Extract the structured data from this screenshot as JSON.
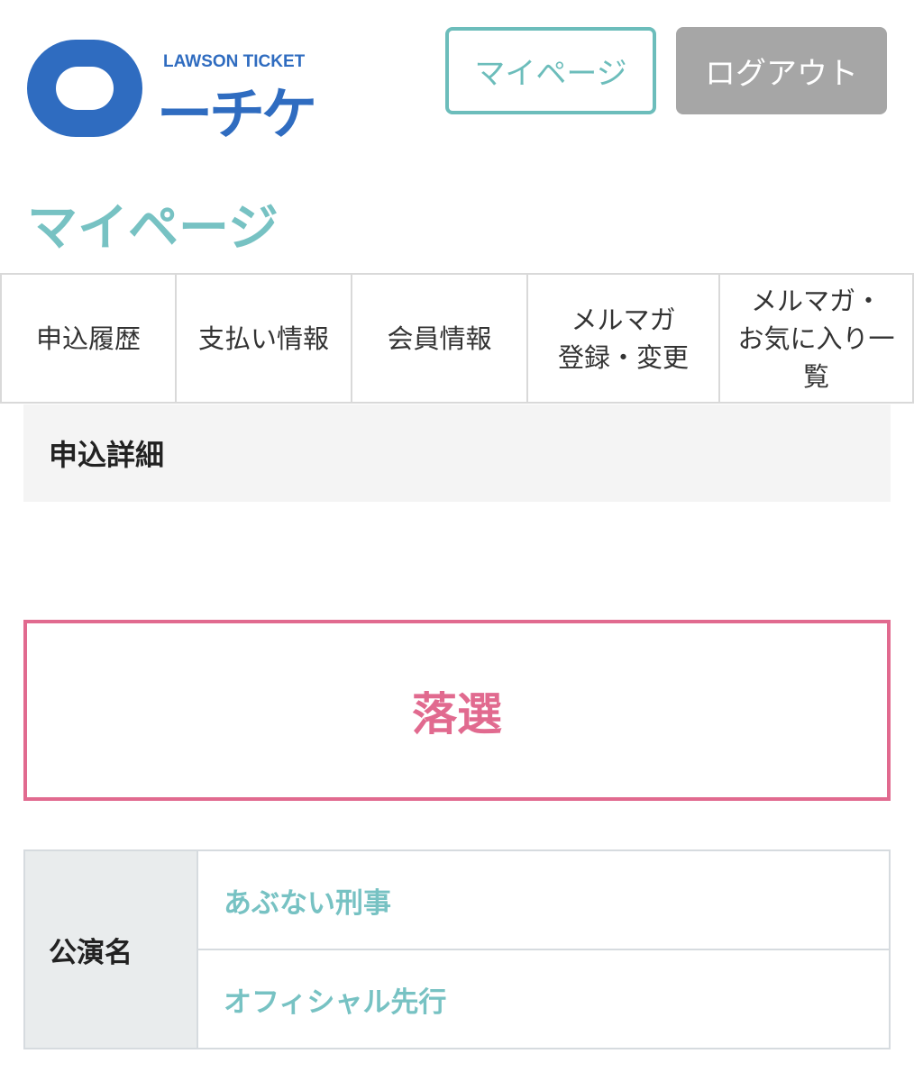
{
  "header": {
    "logo_sub": "LAWSON TICKET",
    "logo_main": "ーチケ",
    "mypage_label": "マイページ",
    "logout_label": "ログアウト"
  },
  "page": {
    "title": "マイページ"
  },
  "tabs": [
    {
      "label": "申込履歴"
    },
    {
      "label": "支払い情報"
    },
    {
      "label": "会員情報"
    },
    {
      "label": "メルマガ\n登録・変更"
    },
    {
      "label": "メルマガ・\nお気に入り一\n覧"
    }
  ],
  "section": {
    "heading": "申込詳細"
  },
  "result": {
    "status": "落選"
  },
  "info": {
    "label": "公演名",
    "rows": [
      {
        "value": "あぶない刑事"
      },
      {
        "value": "オフィシャル先行"
      }
    ]
  },
  "colors": {
    "accent_teal": "#6cbdbb",
    "logo_blue": "#2f6cc0",
    "result_pink": "#e16a8f",
    "logout_gray": "#a6a6a6"
  }
}
